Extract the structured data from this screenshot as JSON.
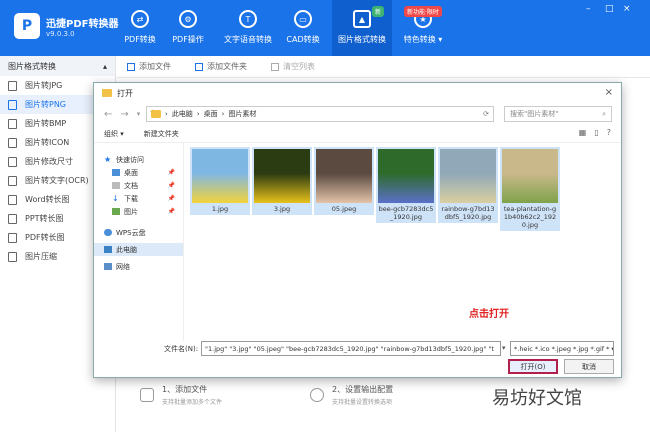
{
  "app": {
    "name": "迅捷PDF转换器",
    "version": "v9.0.3.0",
    "brand_color": "#1a73e8"
  },
  "nav": [
    {
      "label": "PDF转换",
      "icon": "convert-icon"
    },
    {
      "label": "PDF操作",
      "icon": "settings-icon"
    },
    {
      "label": "文字语音转换",
      "icon": "speech-icon"
    },
    {
      "label": "CAD转换",
      "icon": "cad-icon"
    },
    {
      "label": "图片格式转换",
      "icon": "image-icon",
      "active": true,
      "badge": "新"
    },
    {
      "label": "特色转换",
      "icon": "star-icon",
      "badge": "新功能·限时"
    }
  ],
  "window_controls": [
    "–",
    "□",
    "×"
  ],
  "sidebar": {
    "title": "图片格式转换",
    "items": [
      {
        "label": "图片转JPG"
      },
      {
        "label": "图片转PNG",
        "active": true
      },
      {
        "label": "图片转BMP"
      },
      {
        "label": "图片转ICON"
      },
      {
        "label": "图片修改尺寸"
      },
      {
        "label": "图片转文字(OCR)"
      },
      {
        "label": "Word转长图"
      },
      {
        "label": "PPT转长图"
      },
      {
        "label": "PDF转长图"
      },
      {
        "label": "图片压缩"
      }
    ]
  },
  "toolbar": {
    "add_file": "添加文件",
    "add_folder": "添加文件夹",
    "clear_list": "清空列表"
  },
  "steps": [
    {
      "title": "1、添加文件",
      "desc": "支持批量添加多个文件"
    },
    {
      "title": "2、设置输出配置",
      "desc": "支持批量设置转换选项"
    }
  ],
  "watermark": "易坊好文馆",
  "dialog": {
    "title": "打开",
    "path": [
      "此电脑",
      "桌面",
      "图片素材"
    ],
    "search_placeholder": "搜索\"图片素材\"",
    "organize": "组织 ▾",
    "new_folder": "新建文件夹",
    "tree": [
      {
        "label": "快速访问",
        "type": "group",
        "icon": "star-icon"
      },
      {
        "label": "桌面",
        "sub": true,
        "pin": true,
        "icon": "desktop-icon"
      },
      {
        "label": "文档",
        "sub": true,
        "pin": true,
        "icon": "document-icon"
      },
      {
        "label": "下载",
        "sub": true,
        "pin": true,
        "icon": "download-icon"
      },
      {
        "label": "图片",
        "sub": true,
        "pin": true,
        "icon": "picture-icon"
      },
      {
        "label": "WPS云盘",
        "type": "group",
        "icon": "cloud-icon"
      },
      {
        "label": "此电脑",
        "type": "group",
        "selected": true,
        "icon": "computer-icon"
      },
      {
        "label": "网络",
        "type": "group",
        "icon": "network-icon"
      }
    ],
    "files": [
      {
        "name": "1.jpg",
        "colors": [
          "#7fb7e3",
          "#f2d33a"
        ],
        "selected": true
      },
      {
        "name": "3.jpg",
        "colors": [
          "#2b3b12",
          "#e8c21a"
        ],
        "selected": true
      },
      {
        "name": "05.jpeg",
        "colors": [
          "#5a4a40",
          "#e3c3a8"
        ],
        "selected": true
      },
      {
        "name": "bee-gcb7283dc5_1920.jpg",
        "colors": [
          "#2e6b2b",
          "#5b70c8"
        ],
        "selected": true
      },
      {
        "name": "rainbow-g7bd13dbf5_1920.jpg",
        "colors": [
          "#90a8b8",
          "#d9cfa0"
        ],
        "selected": true
      },
      {
        "name": "tea-plantation-g1b40b62c2_1920.jpg",
        "colors": [
          "#c9b98a",
          "#7fa24a"
        ],
        "selected": true
      }
    ],
    "filename_label": "文件名(N):",
    "filename_value": "\"1.jpg\" \"3.jpg\" \"05.jpeg\" \"bee-gcb7283dc5_1920.jpg\" \"rainbow-g7bd13dbf5_1920.jpg\" \"t",
    "file_types": "*.heic *.ico *.jpeg *.jpg *.gif *",
    "open_button": "打开(O)",
    "cancel_button": "取消",
    "annotation": "点击打开",
    "annotation_color": "#e02020"
  }
}
